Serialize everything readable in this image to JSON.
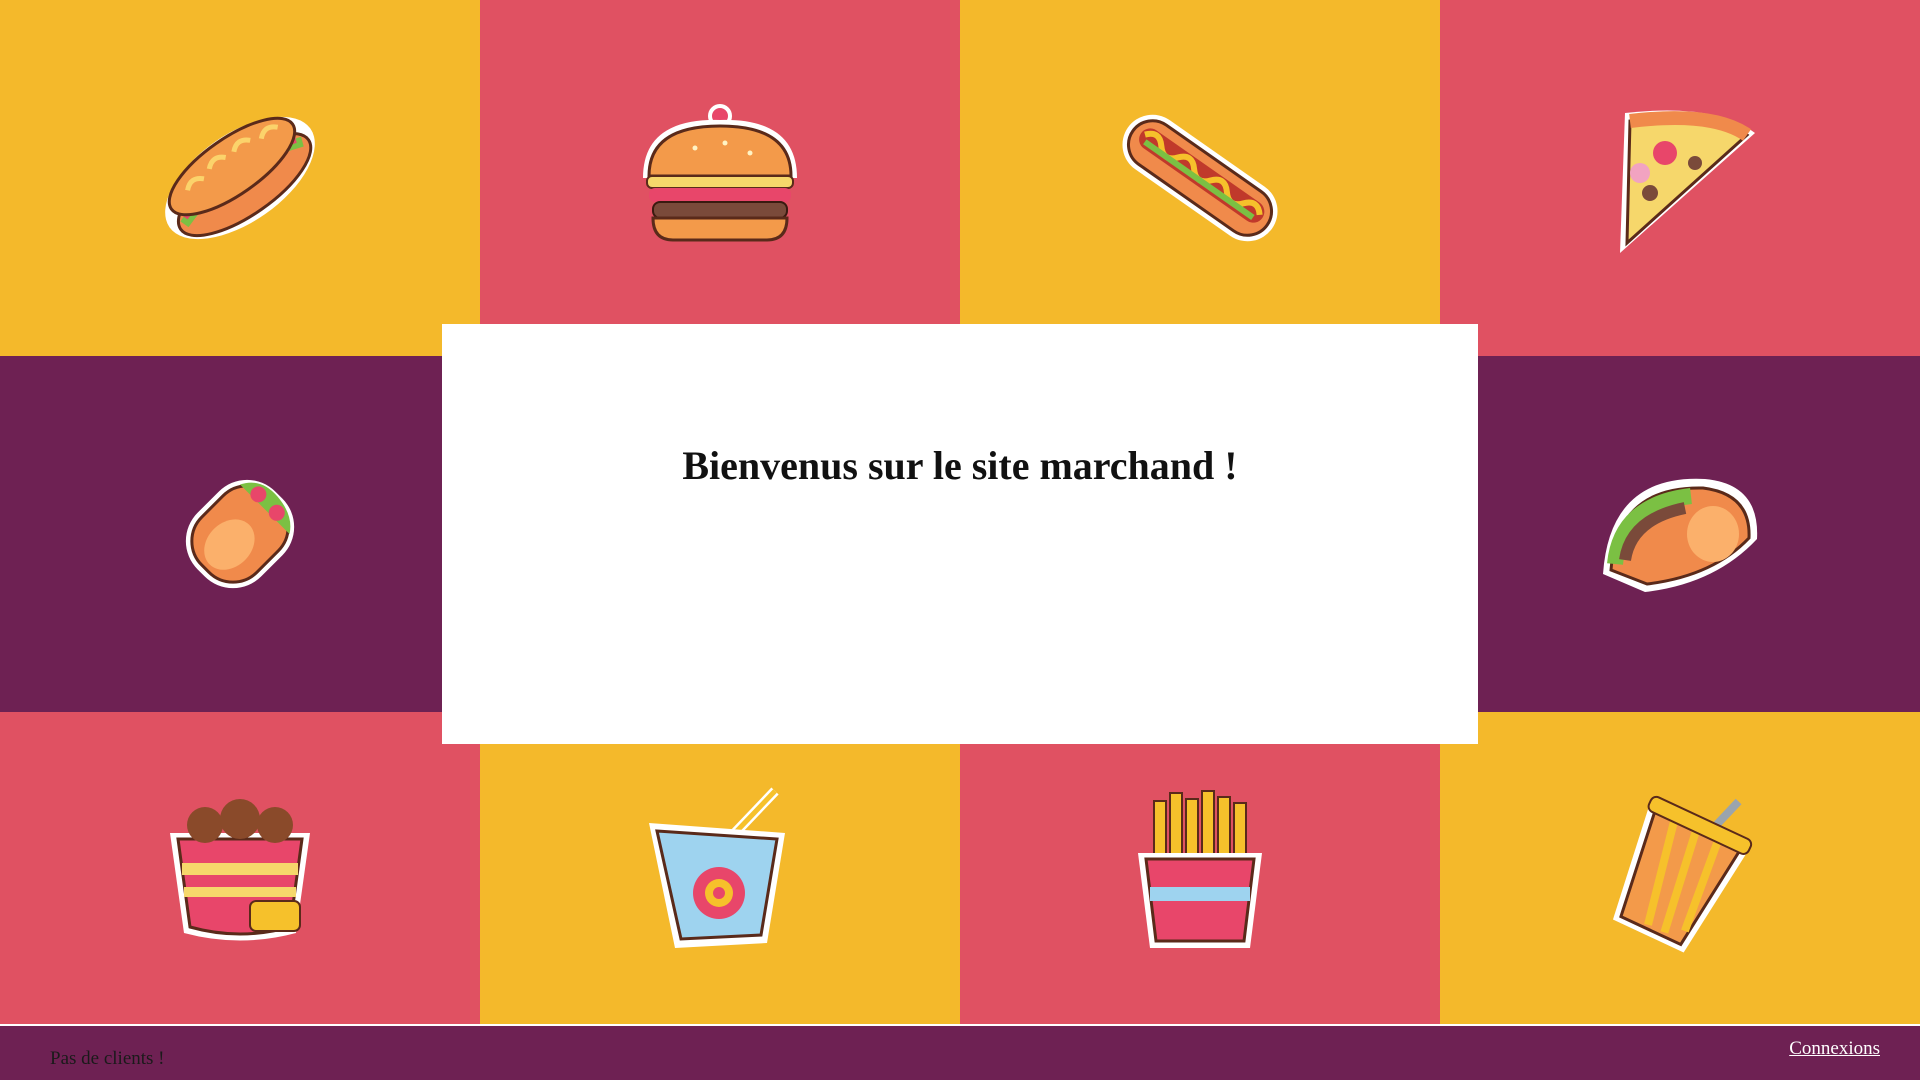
{
  "colors": {
    "yellow": "#F4B92B",
    "red": "#E05162",
    "purple": "#6E2153",
    "white": "#FFFFFF"
  },
  "tiles": [
    {
      "name": "sandwich-icon",
      "color": "yellow"
    },
    {
      "name": "burger-icon",
      "color": "red"
    },
    {
      "name": "hotdog-icon",
      "color": "yellow"
    },
    {
      "name": "pizza-icon",
      "color": "red"
    },
    {
      "name": "burrito-icon",
      "color": "purple"
    },
    {
      "name": "taco-icon",
      "color": "purple"
    },
    {
      "name": "fried-chicken-icon",
      "color": "red"
    },
    {
      "name": "noodle-box-icon",
      "color": "yellow"
    },
    {
      "name": "fries-icon",
      "color": "red"
    },
    {
      "name": "soda-cup-icon",
      "color": "yellow"
    }
  ],
  "panel": {
    "welcome_text": "Bienvenus sur le site marchand !"
  },
  "footer": {
    "status_text": "Pas de clients !",
    "link_label": "Connexions"
  }
}
